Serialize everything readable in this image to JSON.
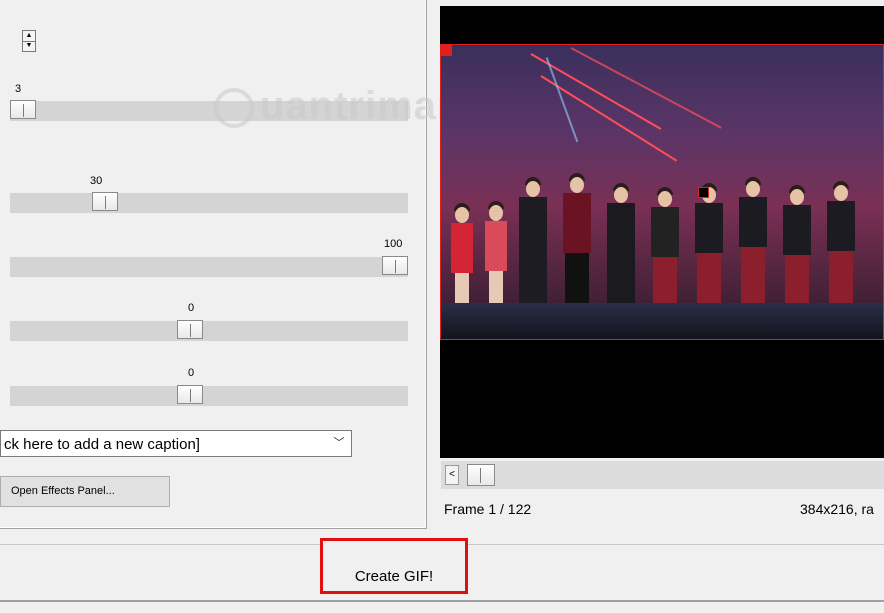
{
  "settings": {
    "spinner": {
      "up_glyph": "▲",
      "down_glyph": "▼"
    },
    "sliders": [
      {
        "id": "slider-1",
        "value": "3",
        "fraction": 0.0
      },
      {
        "id": "slider-2",
        "value": "30",
        "fraction": 0.22
      },
      {
        "id": "slider-3",
        "value": "100",
        "fraction": 1.0
      },
      {
        "id": "slider-4",
        "value": "0",
        "fraction": 0.45
      },
      {
        "id": "slider-5",
        "value": "0",
        "fraction": 0.45
      }
    ],
    "caption_combo": {
      "text": "ck here to add a new caption]",
      "arrow_icon": "chevron-down-icon",
      "arrow_glyph": "﹀"
    },
    "effects_button": "Open Effects Panel..."
  },
  "preview": {
    "scroll_left_glyph": "<",
    "frame_text": "Frame  1 / 122",
    "dims_text": "384x216, ra"
  },
  "watermark": "uantrimang",
  "create_button": "Create GIF!",
  "colors": {
    "selection_border": "#e0201c",
    "highlight_box": "#e01010",
    "panel_bg": "#f0f0f0",
    "track": "#d4d4d4"
  }
}
